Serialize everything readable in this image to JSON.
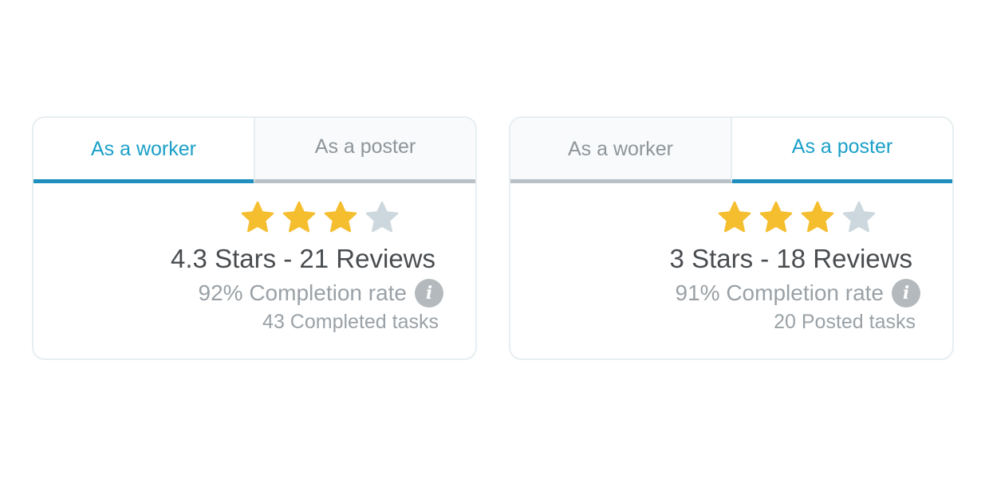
{
  "colors": {
    "active_tab_text": "#1aa0c8",
    "active_tab_underline": "#1f8fc0",
    "inactive_tab_text": "#8e9599",
    "star_filled": "#f5be2e",
    "star_empty": "#cdd8de",
    "info_badge": "#b3b9bd"
  },
  "cards": [
    {
      "tabs": [
        {
          "label": "As a worker",
          "active": true
        },
        {
          "label": "As a poster",
          "active": false
        }
      ],
      "rating": {
        "filled_stars": 3,
        "total_stars": 4
      },
      "summary": "4.3 Stars - 21 Reviews",
      "completion_rate": "92% Completion rate",
      "info_icon": "info-icon",
      "tasks": "43 Completed tasks"
    },
    {
      "tabs": [
        {
          "label": "As a worker",
          "active": false
        },
        {
          "label": "As a poster",
          "active": true
        }
      ],
      "rating": {
        "filled_stars": 3,
        "total_stars": 4
      },
      "summary": "3 Stars - 18 Reviews",
      "completion_rate": "91% Completion rate",
      "info_icon": "info-icon",
      "tasks": "20 Posted tasks"
    }
  ]
}
